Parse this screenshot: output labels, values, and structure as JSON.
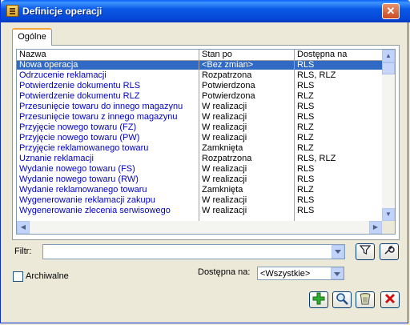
{
  "window": {
    "title": "Definicje operacji",
    "close_label": "✕"
  },
  "tabs": [
    {
      "label": "Ogólne",
      "active": true
    }
  ],
  "table": {
    "columns": [
      "Nazwa",
      "Stan po",
      "Dostępna na"
    ],
    "rows": [
      {
        "name": "Nowa operacja",
        "state": "<Bez zmian>",
        "available": "RLS",
        "selected": true
      },
      {
        "name": "Odrzucenie reklamacji",
        "state": "Rozpatrzona",
        "available": "RLS, RLZ"
      },
      {
        "name": "Potwierdzenie dokumentu RLS",
        "state": "Potwierdzona",
        "available": "RLS"
      },
      {
        "name": "Potwierdzenie dokumentu RLZ",
        "state": "Potwierdzona",
        "available": "RLZ"
      },
      {
        "name": "Przesunięcie towaru do innego magazynu",
        "state": "W realizacji",
        "available": "RLS"
      },
      {
        "name": "Przesunięcie towaru z innego magazynu",
        "state": "W realizacji",
        "available": "RLS"
      },
      {
        "name": "Przyjęcie nowego towaru (FZ)",
        "state": "W realizacji",
        "available": "RLZ"
      },
      {
        "name": "Przyjęcie nowego towaru (PW)",
        "state": "W realizacji",
        "available": "RLZ"
      },
      {
        "name": "Przyjęcie reklamowanego towaru",
        "state": "Zamknięta",
        "available": "RLZ"
      },
      {
        "name": "Uznanie reklamacji",
        "state": "Rozpatrzona",
        "available": "RLS, RLZ"
      },
      {
        "name": "Wydanie nowego towaru (FS)",
        "state": "W realizacji",
        "available": "RLS"
      },
      {
        "name": "Wydanie nowego towaru (RW)",
        "state": "W realizacji",
        "available": "RLS"
      },
      {
        "name": "Wydanie reklamowanego towaru",
        "state": "Zamknięta",
        "available": "RLZ"
      },
      {
        "name": "Wygenerowanie reklamacji zakupu",
        "state": "W realizacji",
        "available": "RLS"
      },
      {
        "name": "Wygenerowanie zlecenia serwisowego",
        "state": "W realizacji",
        "available": "RLS"
      }
    ]
  },
  "filter": {
    "label": "Filtr:",
    "value": ""
  },
  "archived": {
    "label": "Archiwalne",
    "checked": false
  },
  "available_on": {
    "label": "Dostępna na:",
    "value": "<Wszystkie>"
  },
  "icons": {
    "filter": "funnel-icon",
    "options": "wrench-icon",
    "add": "plus-icon",
    "search": "magnifier-icon",
    "trash": "trash-icon",
    "delete": "delete-icon"
  },
  "colors": {
    "selection": "#316ac5",
    "link_text": "#0000c8",
    "titlebar": "#0a59e6"
  }
}
